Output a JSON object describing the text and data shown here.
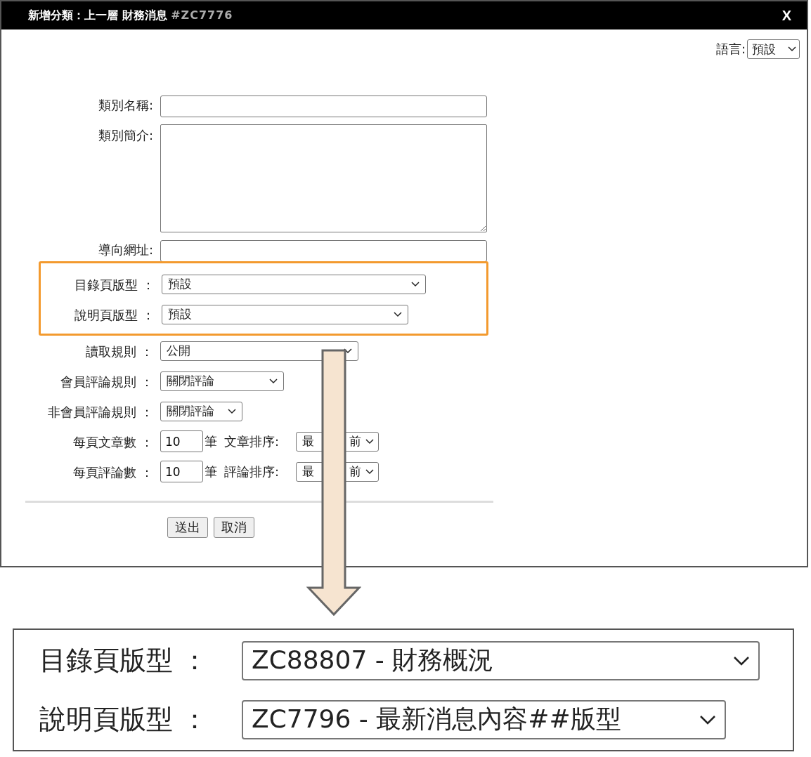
{
  "dialog": {
    "title": "新增分類：上一層 財務消息",
    "title_code": "#ZC7776",
    "close": "X",
    "language": {
      "label": "語言:",
      "value": "預設"
    },
    "fields_top": [
      {
        "kind": "text",
        "label": "類別名稱:"
      },
      {
        "kind": "textarea",
        "label": "類別簡介:"
      },
      {
        "kind": "text",
        "label": "導向網址:"
      }
    ],
    "highlighted_fields": [
      {
        "kind": "select",
        "label": "目錄頁版型 ：",
        "value": "預設"
      },
      {
        "kind": "select",
        "label": "說明頁版型 ：",
        "value": "預設"
      }
    ],
    "fields_bottom": [
      {
        "kind": "select",
        "label": "讀取規則 ：",
        "value": "公開"
      },
      {
        "kind": "select",
        "label": "會員評論規則 ：",
        "value": "關閉評論"
      },
      {
        "kind": "select",
        "label": "非會員評論規則 ：",
        "value": "關閉評論"
      },
      {
        "kind": "count",
        "label": "每頁文章數 ：",
        "value": "10",
        "unit": "筆",
        "sort_label": "文章排序:",
        "sort_start": "最",
        "sort_end": "前"
      },
      {
        "kind": "count",
        "label": "每頁評論數 ：",
        "value": "10",
        "unit": "筆",
        "sort_label": "評論排序:",
        "sort_start": "最",
        "sort_end": "前"
      }
    ],
    "buttons": [
      "送出",
      "取消"
    ]
  },
  "inset": {
    "rows": [
      {
        "label": "目錄頁版型 ：",
        "value": "ZC88807 - 財務概況"
      },
      {
        "label": "說明頁版型 ：",
        "value": "ZC7796 - 最新消息內容##版型"
      }
    ]
  }
}
